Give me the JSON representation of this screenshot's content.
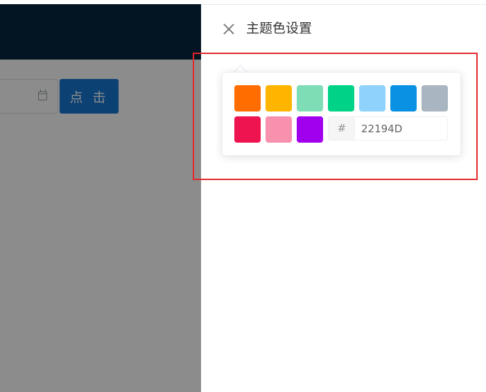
{
  "background": {
    "click_button_label": "点 击"
  },
  "drawer": {
    "title": "主题色设置",
    "close_icon": "close-icon"
  },
  "color_picker": {
    "swatches": [
      {
        "name": "orange",
        "color": "#FF6D00"
      },
      {
        "name": "amber",
        "color": "#FFB400"
      },
      {
        "name": "mint",
        "color": "#7FDDB5"
      },
      {
        "name": "green",
        "color": "#00D287"
      },
      {
        "name": "light-blue",
        "color": "#8FD3FC"
      },
      {
        "name": "blue",
        "color": "#0A91E3"
      },
      {
        "name": "gray",
        "color": "#A9B5C0"
      },
      {
        "name": "crimson",
        "color": "#EE1450"
      },
      {
        "name": "pink",
        "color": "#F891AD"
      },
      {
        "name": "purple",
        "color": "#A000EE"
      }
    ],
    "hex_prefix": "#",
    "hex_value": "22194D"
  },
  "colors": {
    "header_bg": "#031522",
    "primary_button": "#1677D2",
    "highlight_border": "#E1272B"
  }
}
